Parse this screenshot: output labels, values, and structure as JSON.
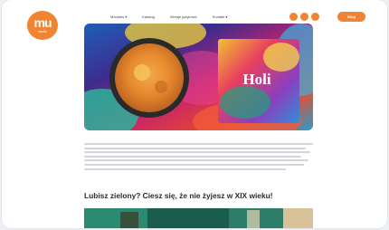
{
  "brand": {
    "logo_mark": "mu",
    "logo_sub": "studio"
  },
  "nav": {
    "items": [
      "Modules ▾",
      "Katalog",
      "Wersje językowe",
      "Kontakt ▾"
    ],
    "social_icons": [
      "facebook-icon",
      "instagram-icon",
      "youtube-icon"
    ],
    "cta_label": "Blog"
  },
  "hero": {
    "box_title": "Holi"
  },
  "article": {
    "heading": "Lubisz zielony? Ciesz się, że nie żyjesz w XIX wieku!"
  },
  "colors": {
    "accent": "#f08433"
  }
}
